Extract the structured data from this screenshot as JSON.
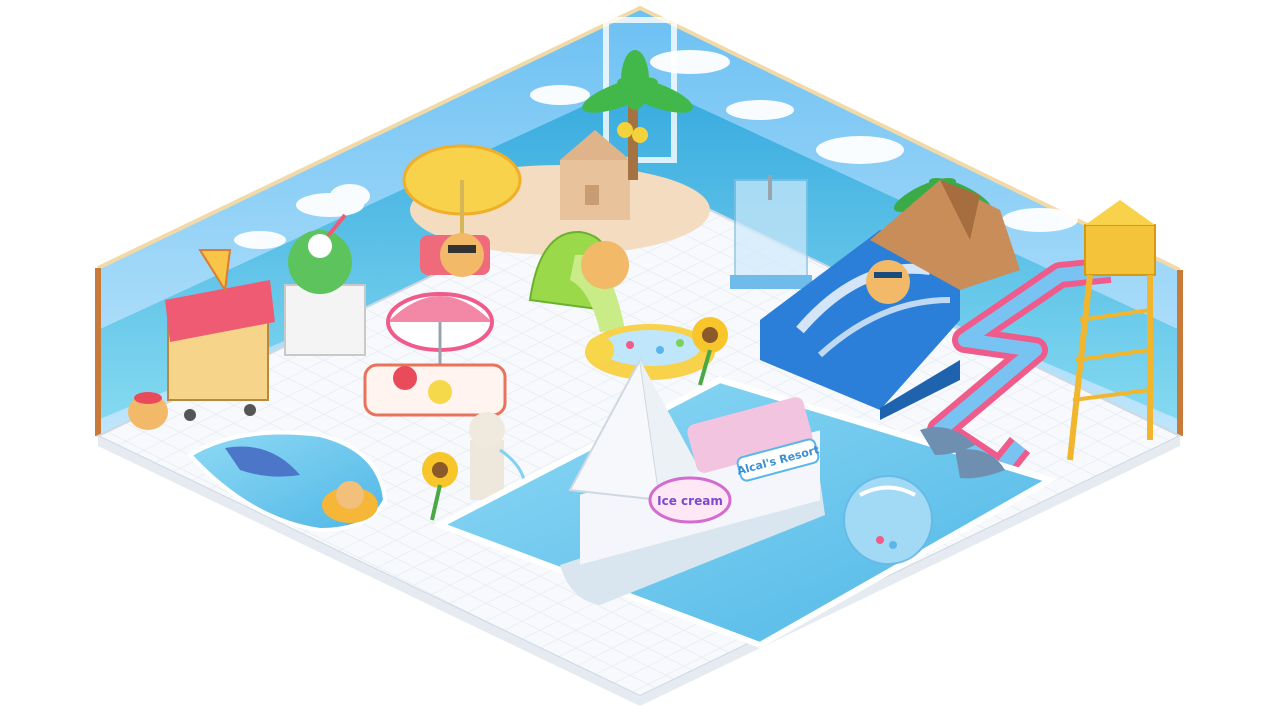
{
  "scene": {
    "title": "",
    "room_type": "isometric water park resort room"
  },
  "signs": {
    "boat_sign_1": "Ice cream",
    "boat_sign_2": "Alcal's Resort"
  },
  "colors": {
    "sky": "#8ccff5",
    "sea": "#3fb6e4",
    "pool": "#7fd2f2",
    "floor": "#f6f8fb",
    "grid": "#dfe6ee",
    "accent_pink": "#ee6fa6",
    "accent_yellow": "#f8d24a",
    "slide_blue": "#2c7fd8"
  },
  "objects": [
    {
      "name": "pizza-stand"
    },
    {
      "name": "coconut-drink-cart"
    },
    {
      "name": "yellow-umbrella-chair"
    },
    {
      "name": "sandcastle-island"
    },
    {
      "name": "elephant-slide"
    },
    {
      "name": "shower-booth"
    },
    {
      "name": "surf-wave-pool"
    },
    {
      "name": "rainbow-water-slide"
    },
    {
      "name": "lifeguard-tower"
    },
    {
      "name": "striped-lounge-chair"
    },
    {
      "name": "dolphin-pool"
    },
    {
      "name": "duck-ball-pool"
    },
    {
      "name": "resort-boat"
    },
    {
      "name": "beach-ball"
    },
    {
      "name": "shark-fountains"
    },
    {
      "name": "sunflower"
    },
    {
      "name": "fountain-statue"
    }
  ]
}
